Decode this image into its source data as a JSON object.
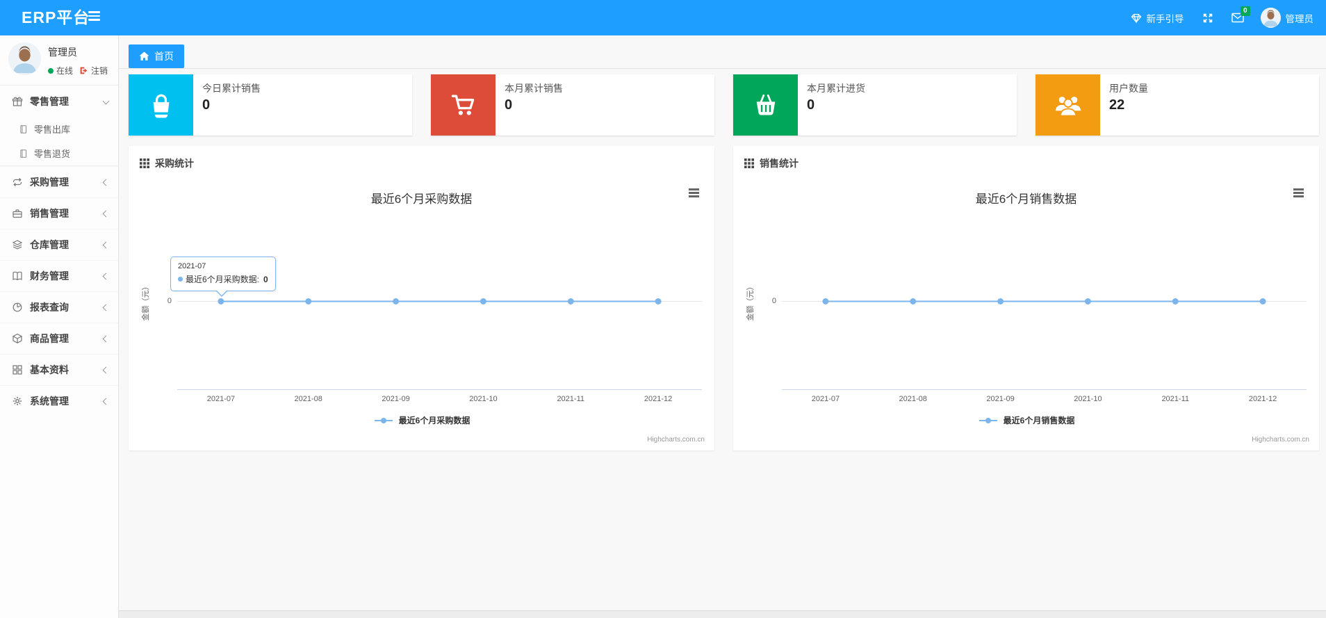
{
  "colors": {
    "primary": "#1e9fff",
    "line": "#7cb5ec",
    "stat_cyan": "#00c0ef",
    "stat_red": "#dd4b39",
    "stat_green": "#00a65a",
    "stat_orange": "#f39c12",
    "badge_green": "#00a65a",
    "online_green": "#00a65a",
    "logout_red": "#dd4b39"
  },
  "navbar": {
    "brand": "ERP平台",
    "guide_label": "新手引导",
    "mail_badge": "0",
    "user_name": "管理员"
  },
  "sidebar": {
    "user": {
      "name": "管理员",
      "status": "在线",
      "logout": "注销"
    },
    "items": [
      {
        "label": "零售管理"
      },
      {
        "label": "零售出库"
      },
      {
        "label": "零售退货"
      },
      {
        "label": "采购管理"
      },
      {
        "label": "销售管理"
      },
      {
        "label": "仓库管理"
      },
      {
        "label": "财务管理"
      },
      {
        "label": "报表查询"
      },
      {
        "label": "商品管理"
      },
      {
        "label": "基本资料"
      },
      {
        "label": "系统管理"
      }
    ]
  },
  "tabs": {
    "home": "首页"
  },
  "stats": [
    {
      "label": "今日累计销售",
      "value": "0",
      "color": "#00c0ef"
    },
    {
      "label": "本月累计销售",
      "value": "0",
      "color": "#dd4b39"
    },
    {
      "label": "本月累计进货",
      "value": "0",
      "color": "#00a65a"
    },
    {
      "label": "用户数量",
      "value": "22",
      "color": "#f39c12"
    }
  ],
  "panels": [
    {
      "header": "采购统计",
      "credit": "Highcharts.com.cn",
      "tooltip": {
        "date": "2021-07",
        "series_label": "最近6个月采购数据:",
        "value": "0"
      }
    },
    {
      "header": "销售统计",
      "credit": "Highcharts.com.cn"
    }
  ],
  "chart_data": [
    {
      "type": "line",
      "title": "最近6个月采购数据",
      "series_name": "最近6个月采购数据",
      "categories": [
        "2021-07",
        "2021-08",
        "2021-09",
        "2021-10",
        "2021-11",
        "2021-12"
      ],
      "values": [
        0,
        0,
        0,
        0,
        0,
        0
      ],
      "xlabel": "",
      "ylabel": "金额（元）",
      "y_ticks": [
        "0"
      ],
      "ylim": [
        -1,
        1
      ],
      "color": "#7cb5ec",
      "grid": true,
      "legend_position": "bottom"
    },
    {
      "type": "line",
      "title": "最近6个月销售数据",
      "series_name": "最近6个月销售数据",
      "categories": [
        "2021-07",
        "2021-08",
        "2021-09",
        "2021-10",
        "2021-11",
        "2021-12"
      ],
      "values": [
        0,
        0,
        0,
        0,
        0,
        0
      ],
      "xlabel": "",
      "ylabel": "金额（元）",
      "y_ticks": [
        "0"
      ],
      "ylim": [
        -1,
        1
      ],
      "color": "#7cb5ec",
      "grid": true,
      "legend_position": "bottom"
    }
  ]
}
